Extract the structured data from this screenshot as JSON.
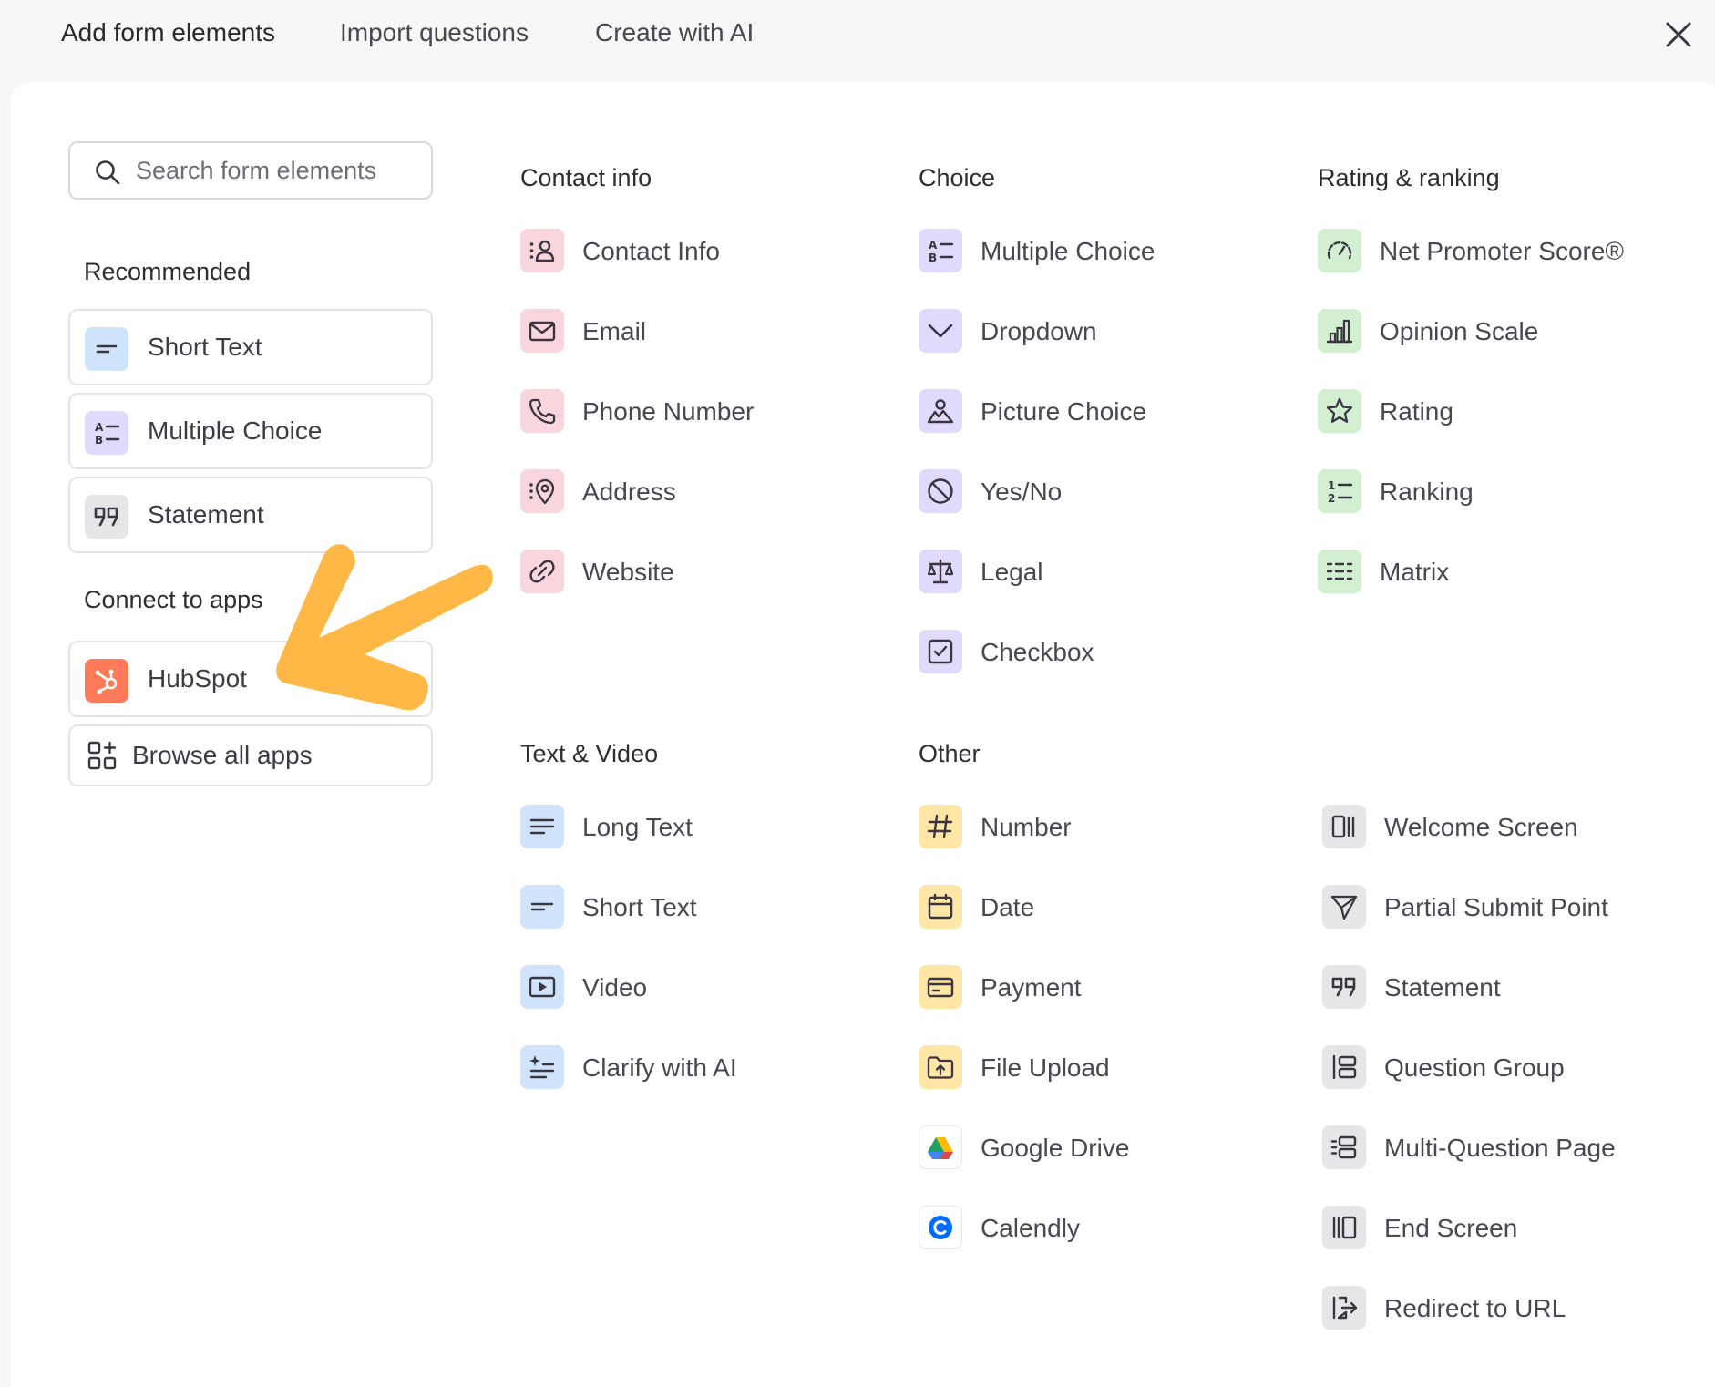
{
  "tabs": [
    {
      "label": "Add form elements"
    },
    {
      "label": "Import questions"
    },
    {
      "label": "Create with AI"
    }
  ],
  "search": {
    "placeholder": "Search form elements"
  },
  "recommended": {
    "heading": "Recommended",
    "items": [
      {
        "label": "Short Text",
        "icon": "short-text-icon",
        "color": "#cfe4fb"
      },
      {
        "label": "Multiple Choice",
        "icon": "multiple-choice-icon",
        "color": "#e2dafc"
      },
      {
        "label": "Statement",
        "icon": "quote-icon",
        "color": "#e6e6e8"
      }
    ]
  },
  "connect": {
    "heading": "Connect to apps",
    "items": [
      {
        "label": "HubSpot",
        "icon": "hubspot-icon",
        "color": "#ff7a59"
      }
    ],
    "browse_label": "Browse all apps"
  },
  "contact_info": {
    "heading": "Contact info",
    "items": [
      {
        "label": "Contact Info",
        "icon": "contact-info-icon"
      },
      {
        "label": "Email",
        "icon": "email-icon"
      },
      {
        "label": "Phone Number",
        "icon": "phone-icon"
      },
      {
        "label": "Address",
        "icon": "address-pin-icon"
      },
      {
        "label": "Website",
        "icon": "link-icon"
      }
    ]
  },
  "choice": {
    "heading": "Choice",
    "items": [
      {
        "label": "Multiple Choice",
        "icon": "multiple-choice-icon"
      },
      {
        "label": "Dropdown",
        "icon": "chevron-down-icon"
      },
      {
        "label": "Picture Choice",
        "icon": "picture-choice-icon"
      },
      {
        "label": "Yes/No",
        "icon": "yes-no-icon"
      },
      {
        "label": "Legal",
        "icon": "scales-icon"
      },
      {
        "label": "Checkbox",
        "icon": "checkbox-icon"
      }
    ]
  },
  "rating": {
    "heading": "Rating & ranking",
    "items": [
      {
        "label": "Net Promoter Score®",
        "icon": "gauge-icon"
      },
      {
        "label": "Opinion Scale",
        "icon": "bar-chart-icon"
      },
      {
        "label": "Rating",
        "icon": "star-icon"
      },
      {
        "label": "Ranking",
        "icon": "ranking-icon"
      },
      {
        "label": "Matrix",
        "icon": "matrix-icon"
      }
    ]
  },
  "text_video": {
    "heading": "Text & Video",
    "items": [
      {
        "label": "Long Text",
        "icon": "long-text-icon"
      },
      {
        "label": "Short Text",
        "icon": "short-text-icon"
      },
      {
        "label": "Video",
        "icon": "video-play-icon"
      },
      {
        "label": "Clarify with AI",
        "icon": "clarify-ai-icon"
      }
    ]
  },
  "other": {
    "heading": "Other",
    "items": [
      {
        "label": "Number",
        "icon": "hash-icon"
      },
      {
        "label": "Date",
        "icon": "calendar-icon"
      },
      {
        "label": "Payment",
        "icon": "credit-card-icon"
      },
      {
        "label": "File Upload",
        "icon": "file-upload-icon"
      },
      {
        "label": "Google Drive",
        "icon": "google-drive-icon"
      },
      {
        "label": "Calendly",
        "icon": "calendly-icon"
      }
    ]
  },
  "screens": {
    "items": [
      {
        "label": "Welcome Screen",
        "icon": "welcome-screen-icon"
      },
      {
        "label": "Partial Submit Point",
        "icon": "send-icon"
      },
      {
        "label": "Statement",
        "icon": "quote-icon"
      },
      {
        "label": "Question Group",
        "icon": "question-group-icon"
      },
      {
        "label": "Multi-Question Page",
        "icon": "multi-question-icon"
      },
      {
        "label": "End Screen",
        "icon": "end-screen-icon"
      },
      {
        "label": "Redirect to URL",
        "icon": "redirect-icon"
      }
    ]
  },
  "colors": {
    "contact": "#f9d6de",
    "choice": "#e2dafc",
    "rating": "#d3efd2",
    "text_video": "#cfe4fb",
    "other": "#fde6a6",
    "screens": "#e6e6e8",
    "arrow": "#ffb845",
    "icon_stroke": "#3a3540"
  }
}
